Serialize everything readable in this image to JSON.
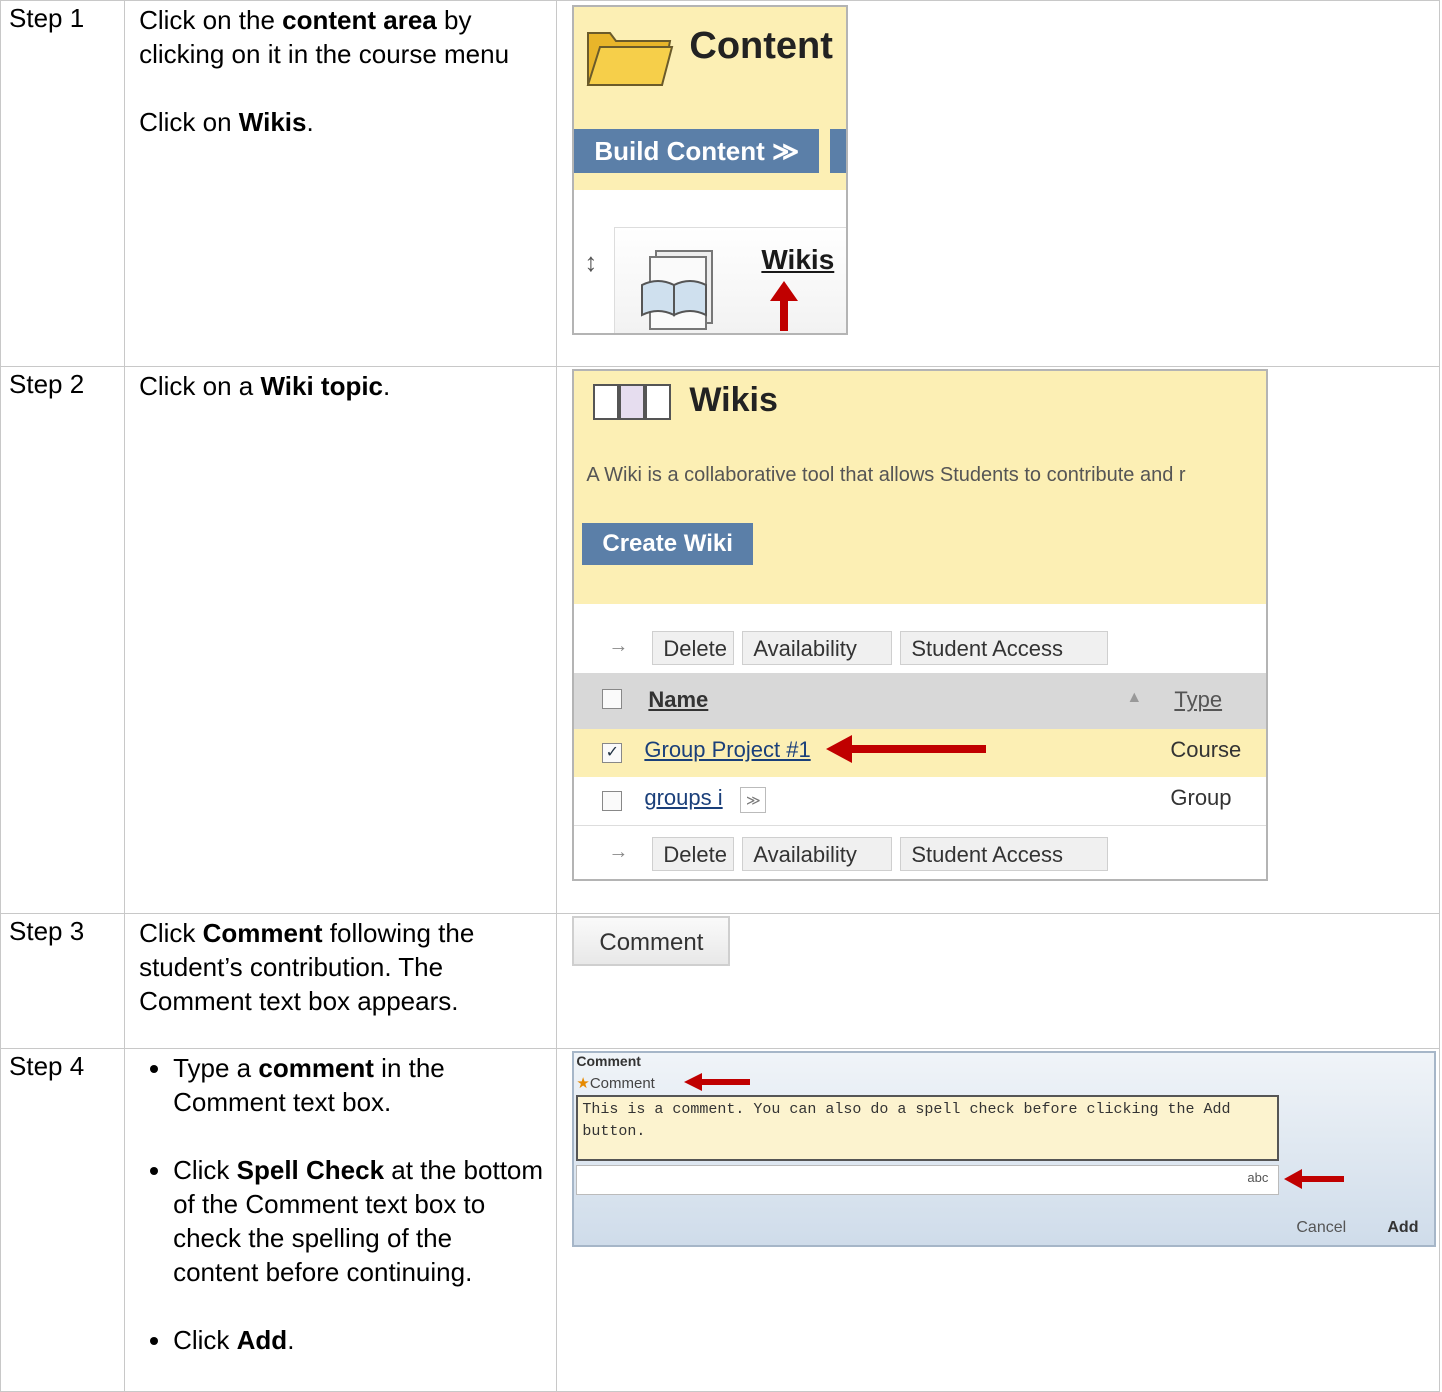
{
  "steps": [
    {
      "label": "Step 1"
    },
    {
      "label": "Step 2"
    },
    {
      "label": "Step 3"
    },
    {
      "label": "Step 4"
    }
  ],
  "step1": {
    "t1": "Click on the ",
    "b1": "content area",
    "t2": " by clicking on it in the course menu",
    "t3": "Click on ",
    "b2": "Wikis",
    "t4": ".",
    "shot": {
      "title": "Content",
      "build_btn": "Build Content ≫",
      "link": "Wikis"
    }
  },
  "step2": {
    "t1": "Click on a ",
    "b1": "Wiki topic",
    "t2": ".",
    "shot": {
      "title": "Wikis",
      "desc": "A Wiki is a collaborative tool that allows Students to contribute and r",
      "create_btn": "Create Wiki",
      "actions": {
        "delete": "Delete",
        "availability": "Availability",
        "student_access": "Student Access"
      },
      "headers": {
        "name": "Name",
        "type": "Type"
      },
      "rows": [
        {
          "name": "Group Project #1",
          "type": "Course"
        },
        {
          "name": "groups i",
          "type": "Group"
        }
      ]
    }
  },
  "step3": {
    "t1": "Click ",
    "b1": "Comment",
    "t2": " following the student’s contribution. The Comment text box appears.",
    "shot": {
      "button": "Comment"
    }
  },
  "step4": {
    "b1_t1": "Type a ",
    "b1_b": "comment",
    "b1_t2": " in the Comment text box.",
    "b2_t1": "Click ",
    "b2_b": "Spell Check",
    "b2_t2": " at the bottom of the Comment text box to check the spelling of the content before continuing.",
    "b3_t1": "Click ",
    "b3_b": "Add",
    "b3_t2": ".",
    "shot": {
      "heading": "Comment",
      "label": "Comment",
      "text": "This is a comment. You can also do a spell check before clicking the Add button.",
      "spell_icon": "abc",
      "cancel": "Cancel",
      "add": "Add"
    }
  },
  "colors": {
    "arrow": "#c00000",
    "highlight": "#fcefb4",
    "button_blue": "#5b7fa8"
  }
}
